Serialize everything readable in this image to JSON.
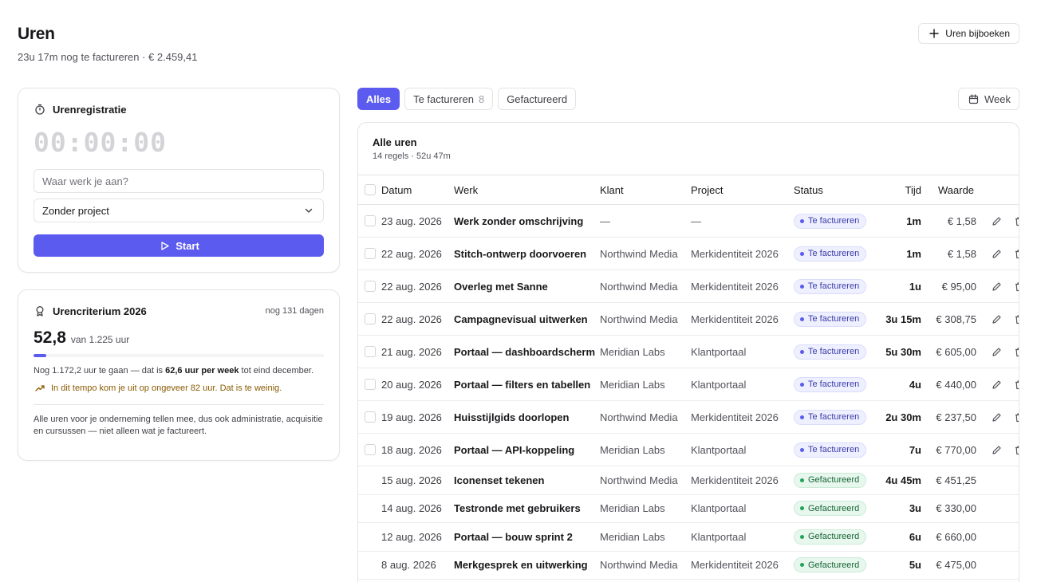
{
  "header": {
    "title": "Uren",
    "subtitle": "23u 17m nog te factureren · € 2.459,41",
    "add_button": "Uren bijboeken"
  },
  "timer": {
    "title": "Urenregistratie",
    "display": "00:00:00",
    "input_placeholder": "Waar werk je aan?",
    "project_select": "Zonder project",
    "start_label": "Start"
  },
  "criterion": {
    "title": "Urencriterium 2026",
    "days_left": "nog 131 dagen",
    "hours_done": "52,8",
    "hours_target": "van 1.225 uur",
    "progress_fraction": 0.043,
    "remaining_pre": "Nog 1.172,2 uur te gaan — dat is",
    "remaining_bold": "62,6 uur per week",
    "remaining_post": "tot eind december.",
    "warning": "In dit tempo kom je uit op ongeveer 82 uur. Dat is te weinig.",
    "note": "Alle uren voor je onderneming tellen mee, dus ook administratie, acquisitie en cursussen — niet alleen wat je factureert."
  },
  "filters": {
    "all": "Alles",
    "to_invoice": "Te factureren",
    "to_invoice_count": "8",
    "invoiced": "Gefactureerd",
    "period": "Week"
  },
  "table": {
    "title": "Alle uren",
    "subtitle": "14 regels · 52u 47m",
    "columns": {
      "date": "Datum",
      "work": "Werk",
      "client": "Klant",
      "project": "Project",
      "status": "Status",
      "time": "Tijd",
      "value": "Waarde"
    },
    "rows": [
      {
        "date": "23 aug. 2026",
        "work": "Werk zonder omschrijving",
        "client": "—",
        "project": "—",
        "status": "Te factureren",
        "time": "1m",
        "value": "€ 1,58"
      },
      {
        "date": "22 aug. 2026",
        "work": "Stitch-ontwerp doorvoeren",
        "client": "Northwind Media",
        "project": "Merkidentiteit 2026",
        "status": "Te factureren",
        "time": "1m",
        "value": "€ 1,58"
      },
      {
        "date": "22 aug. 2026",
        "work": "Overleg met Sanne",
        "client": "Northwind Media",
        "project": "Merkidentiteit 2026",
        "status": "Te factureren",
        "time": "1u",
        "value": "€ 95,00"
      },
      {
        "date": "22 aug. 2026",
        "work": "Campagnevisual uitwerken",
        "client": "Northwind Media",
        "project": "Merkidentiteit 2026",
        "status": "Te factureren",
        "time": "3u 15m",
        "value": "€ 308,75"
      },
      {
        "date": "21 aug. 2026",
        "work": "Portaal — dashboardscherm",
        "client": "Meridian Labs",
        "project": "Klantportaal",
        "status": "Te factureren",
        "time": "5u 30m",
        "value": "€ 605,00"
      },
      {
        "date": "20 aug. 2026",
        "work": "Portaal — filters en tabellen",
        "client": "Meridian Labs",
        "project": "Klantportaal",
        "status": "Te factureren",
        "time": "4u",
        "value": "€ 440,00"
      },
      {
        "date": "19 aug. 2026",
        "work": "Huisstijlgids doorlopen",
        "client": "Northwind Media",
        "project": "Merkidentiteit 2026",
        "status": "Te factureren",
        "time": "2u 30m",
        "value": "€ 237,50"
      },
      {
        "date": "18 aug. 2026",
        "work": "Portaal — API-koppeling",
        "client": "Meridian Labs",
        "project": "Klantportaal",
        "status": "Te factureren",
        "time": "7u",
        "value": "€ 770,00"
      },
      {
        "date": "15 aug. 2026",
        "work": "Iconenset tekenen",
        "client": "Northwind Media",
        "project": "Merkidentiteit 2026",
        "status": "Gefactureerd",
        "time": "4u 45m",
        "value": "€ 451,25"
      },
      {
        "date": "14 aug. 2026",
        "work": "Testronde met gebruikers",
        "client": "Meridian Labs",
        "project": "Klantportaal",
        "status": "Gefactureerd",
        "time": "3u",
        "value": "€ 330,00"
      },
      {
        "date": "12 aug. 2026",
        "work": "Portaal — bouw sprint 2",
        "client": "Meridian Labs",
        "project": "Klantportaal",
        "status": "Gefactureerd",
        "time": "6u",
        "value": "€ 660,00"
      },
      {
        "date": "8 aug. 2026",
        "work": "Merkgesprek en uitwerking",
        "client": "Northwind Media",
        "project": "Merkidentiteit 2026",
        "status": "Gefactureerd",
        "time": "5u",
        "value": "€ 475,00"
      }
    ]
  },
  "colors": {
    "accent": "#5b5bf0",
    "pending_badge": "#eef0ff",
    "invoiced_badge": "#e8f7ee",
    "warning_text": "#8a5a00"
  },
  "icons": {
    "add": "plus-icon",
    "timer": "stopwatch-icon",
    "select": "chevron-down-icon",
    "start": "play-icon",
    "criterion": "award-icon",
    "warning": "trending-up-icon",
    "calendar": "calendar-icon",
    "edit": "pencil-icon",
    "delete": "trash-icon"
  }
}
